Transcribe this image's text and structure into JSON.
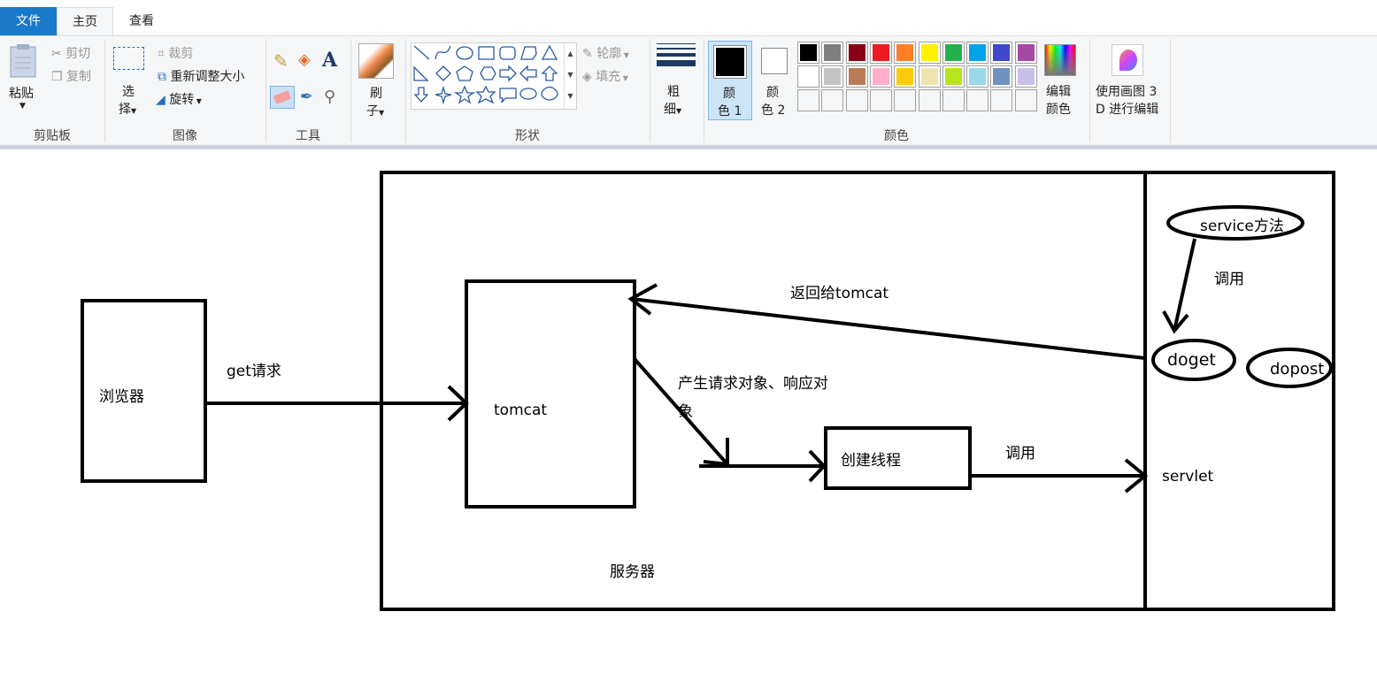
{
  "tabs": [
    {
      "label": "文件",
      "active": false
    },
    {
      "label": "主页",
      "active": true
    },
    {
      "label": "查看",
      "active": false
    }
  ],
  "clipboard": {
    "paste": "粘贴",
    "cut": "剪切",
    "copy": "复制",
    "group": "剪贴板"
  },
  "image": {
    "select_1": "选",
    "select_2": "择",
    "crop": "裁剪",
    "resize": "重新调整大小",
    "rotate": "旋转",
    "group": "图像"
  },
  "tools": {
    "group": "工具"
  },
  "brush": {
    "label_1": "刷",
    "label_2": "子"
  },
  "shapes": {
    "outline": "轮廓",
    "fill": "填充",
    "group": "形状"
  },
  "size": {
    "label_1": "粗",
    "label_2": "细"
  },
  "colors": {
    "color1_a": "颜",
    "color1_b": "色 1",
    "color2_a": "颜",
    "color2_b": "色 2",
    "edit_a": "编辑",
    "edit_b": "颜色",
    "group": "颜色",
    "palette": [
      "#000000",
      "#7f7f7f",
      "#880015",
      "#ed1c24",
      "#ff7f27",
      "#fff200",
      "#22b14c",
      "#00a2e8",
      "#3f48cc",
      "#a349a4",
      "#ffffff",
      "#c3c3c3",
      "#b97a57",
      "#ffaec9",
      "#ffc90e",
      "#efe4b0",
      "#b5e61d",
      "#99d9ea",
      "#7092be",
      "#c8bfe7"
    ],
    "primary": "#000000",
    "secondary": "#ffffff"
  },
  "paint3d": {
    "label_1": "使用画图 3",
    "label_2": "D 进行编辑"
  },
  "diagram": {
    "browser": "浏览器",
    "get_request": "get请求",
    "tomcat": "tomcat",
    "return_to_tomcat": "返回给tomcat",
    "create_objects_1": "产生请求对象、响应对",
    "create_objects_2": "象",
    "create_thread": "创建线程",
    "invoke_1": "调用",
    "invoke_2": "调用",
    "service_method": "service方法",
    "doget": "doget",
    "dopost": "dopost",
    "servlet": "servlet",
    "server": "服务器"
  }
}
